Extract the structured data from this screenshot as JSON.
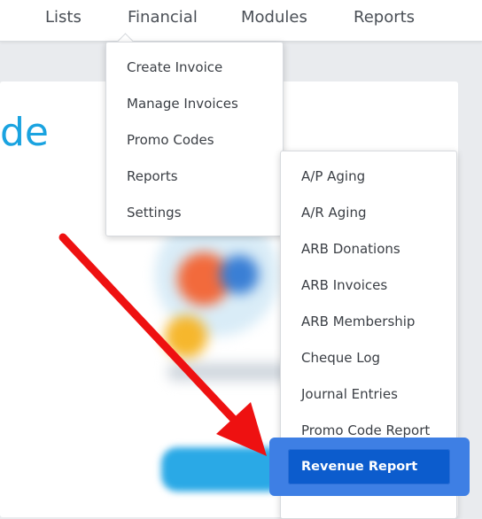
{
  "topnav": {
    "items": [
      {
        "label": "Lists"
      },
      {
        "label": "Financial"
      },
      {
        "label": "Modules"
      },
      {
        "label": "Reports"
      }
    ]
  },
  "page": {
    "hero_text": "de"
  },
  "financial_menu": {
    "items": [
      {
        "label": "Create Invoice"
      },
      {
        "label": "Manage Invoices"
      },
      {
        "label": "Promo Codes"
      },
      {
        "label": "Reports"
      },
      {
        "label": "Settings"
      }
    ]
  },
  "reports_submenu": {
    "items": [
      {
        "label": "A/P Aging"
      },
      {
        "label": "A/R Aging"
      },
      {
        "label": "ARB Donations"
      },
      {
        "label": "ARB Invoices"
      },
      {
        "label": "ARB Membership"
      },
      {
        "label": "Cheque Log"
      },
      {
        "label": "Journal Entries"
      },
      {
        "label": "Promo Code Report"
      }
    ],
    "highlighted_item": "Revenue Report"
  },
  "colors": {
    "arrow": "#ee1111",
    "highlight_frame": "#3e7fe4",
    "highlight_button": "#0c5ccd",
    "hero_text": "#1aa3e0"
  }
}
